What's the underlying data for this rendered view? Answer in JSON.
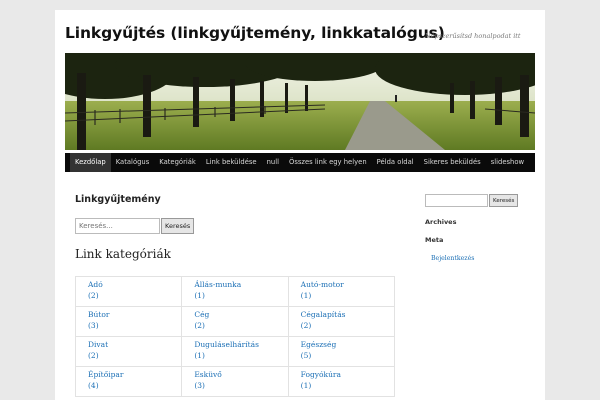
{
  "site": {
    "title": "Linkgyűjtés (linkgyűjtemény, linkkatalógus)",
    "description": "Népszerűsítsd honalpodat itt"
  },
  "nav": {
    "items": [
      {
        "label": "Kezdőlap",
        "active": true
      },
      {
        "label": "Katalógus"
      },
      {
        "label": "Kategóriák"
      },
      {
        "label": "Link beküldése"
      },
      {
        "label": "null"
      },
      {
        "label": "Összes link egy helyen"
      },
      {
        "label": "Példa oldal"
      },
      {
        "label": "Sikeres beküldés"
      },
      {
        "label": "slideshow"
      }
    ]
  },
  "main": {
    "page_title": "Linkgyűjtemény",
    "search": {
      "placeholder": "Keresés...",
      "button_label": "Keresés"
    },
    "categories_heading": "Link kategóriák",
    "categories": [
      {
        "name": "Adó",
        "count": "(2)"
      },
      {
        "name": "Állás-munka",
        "count": "(1)"
      },
      {
        "name": "Autó-motor",
        "count": "(1)"
      },
      {
        "name": "Bútor",
        "count": "(3)"
      },
      {
        "name": "Cég",
        "count": "(2)"
      },
      {
        "name": "Cégalapítás",
        "count": "(2)"
      },
      {
        "name": "Divat",
        "count": "(2)"
      },
      {
        "name": "Duguláselhárítás",
        "count": "(1)"
      },
      {
        "name": "Egészség",
        "count": "(5)"
      },
      {
        "name": "Építőipar",
        "count": "(4)"
      },
      {
        "name": "Esküvő",
        "count": "(3)"
      },
      {
        "name": "Fogyókúra",
        "count": "(1)"
      }
    ]
  },
  "sidebar": {
    "search": {
      "value": "",
      "button_label": "Keresés"
    },
    "archives_title": "Archives",
    "meta_title": "Meta",
    "meta_link": "Bejelentkezés"
  },
  "colors": {
    "link": "#1b6fb5",
    "nav_bg": "#0a0a0a",
    "page_bg": "#e9e9e9"
  }
}
